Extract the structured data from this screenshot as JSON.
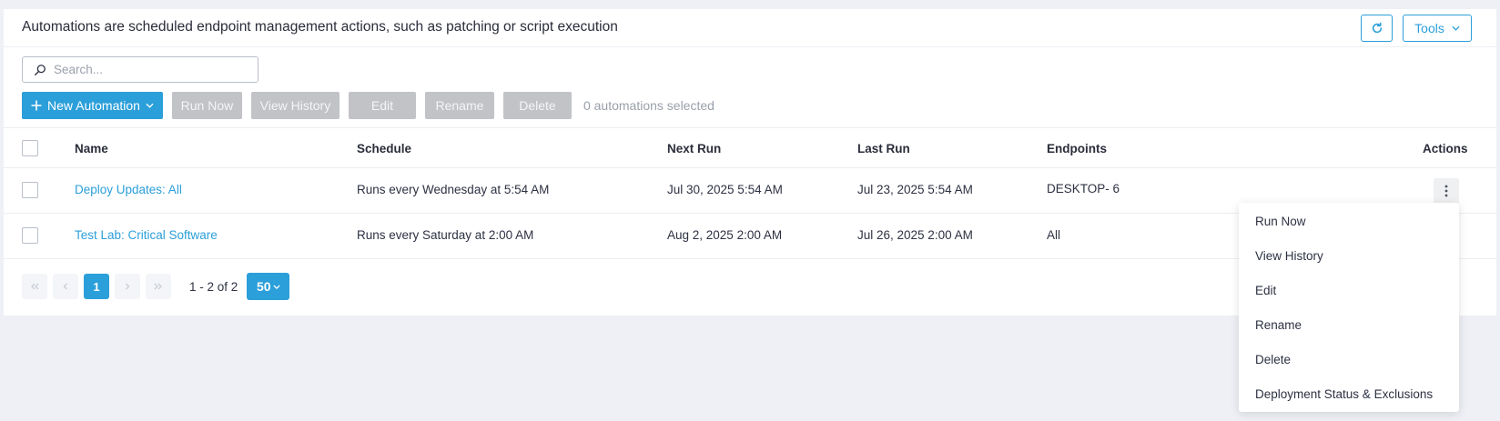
{
  "header": {
    "title": "Automations are scheduled endpoint management actions, such as patching or script execution",
    "tools_label": "Tools"
  },
  "search": {
    "placeholder": "Search..."
  },
  "toolbar": {
    "new_automation": "New Automation",
    "run_now": "Run Now",
    "view_history": "View History",
    "edit": "Edit",
    "rename": "Rename",
    "delete": "Delete",
    "selected_count": "0 automations selected"
  },
  "table": {
    "columns": {
      "name": "Name",
      "schedule": "Schedule",
      "next_run": "Next Run",
      "last_run": "Last Run",
      "endpoints": "Endpoints",
      "actions": "Actions"
    },
    "rows": [
      {
        "name": "Deploy Updates: All",
        "schedule": "Runs every Wednesday at 5:54 AM",
        "next_run": "Jul 30, 2025 5:54 AM",
        "last_run": "Jul 23, 2025 5:54 AM",
        "endpoints": "DESKTOP- 6"
      },
      {
        "name": "Test Lab: Critical Software",
        "schedule": "Runs every Saturday at 2:00 AM",
        "next_run": "Aug 2, 2025 2:00 AM",
        "last_run": "Jul 26, 2025 2:00 AM",
        "endpoints": "All"
      }
    ]
  },
  "pagination": {
    "current_page": "1",
    "range": "1 - 2 of 2",
    "page_size": "50"
  },
  "actions_menu": {
    "items": [
      "Run Now",
      "View History",
      "Edit",
      "Rename",
      "Delete",
      "Deployment Status & Exclusions"
    ]
  },
  "colors": {
    "accent": "#2b9fd9",
    "disabled": "#c1c3c7",
    "background": "#eef0f5"
  },
  "icons": {
    "refresh": "refresh-icon",
    "search": "search-icon",
    "plus": "plus-icon",
    "kebab": "kebab-menu-icon"
  }
}
